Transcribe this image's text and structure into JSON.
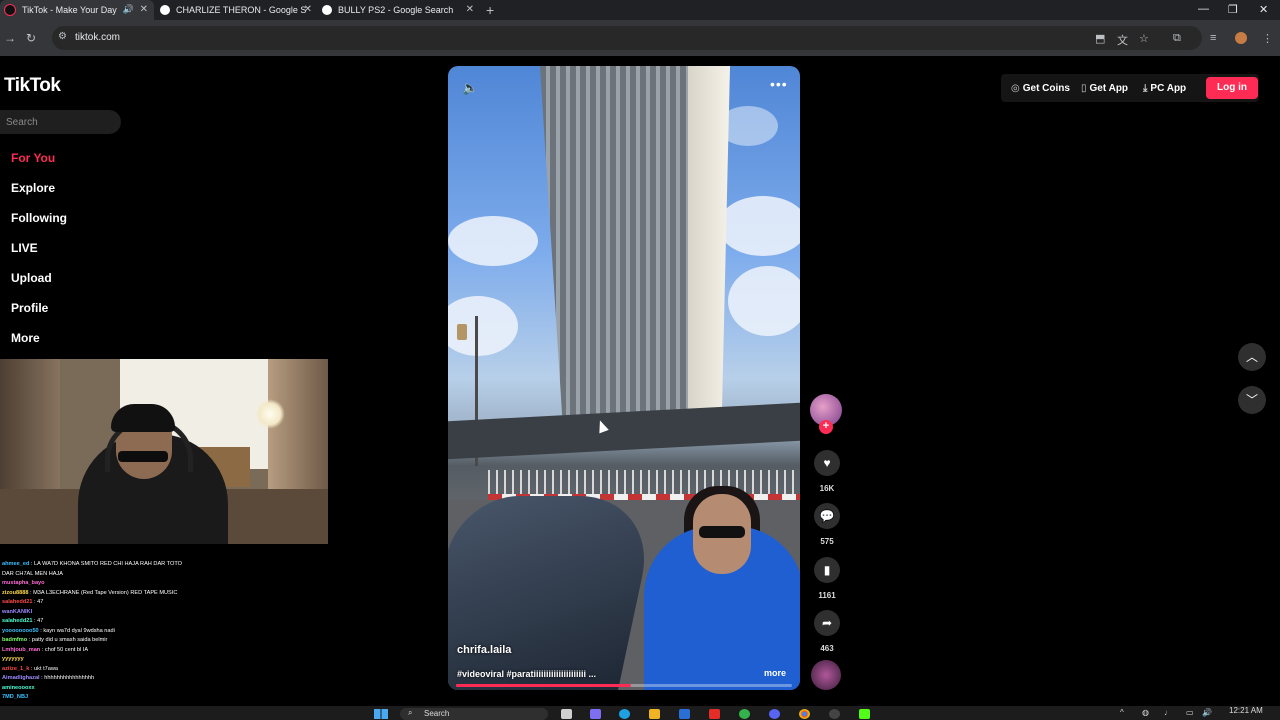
{
  "browser": {
    "tabs": [
      {
        "title": "TikTok - Make Your Day",
        "active": true
      },
      {
        "title": "CHARLIZE THERON - Google S",
        "active": false
      },
      {
        "title": "BULLY PS2 - Google Search",
        "active": false
      }
    ],
    "new_tab": "+",
    "url": "tiktok.com"
  },
  "tiktok": {
    "logo": "TikTok",
    "search_placeholder": "Search",
    "nav": [
      "For You",
      "Explore",
      "Following",
      "LIVE",
      "Upload",
      "Profile",
      "More"
    ],
    "header": {
      "get_coins": "Get Coins",
      "get_app": "Get App",
      "pc_app": "PC App",
      "login": "Log in"
    },
    "video": {
      "author": "chrifa.laila",
      "caption": "#videoviral #paratiiiiiiiiiiiiiiiiiiiii ...",
      "more": "more",
      "progress": 0.52
    },
    "actions": {
      "likes": "16K",
      "comments": "575",
      "saves": "1161",
      "shares": "463"
    }
  },
  "chat": [
    {
      "user": "ahmee_ed",
      "text": "LA WA7D KHONA SMITO RED CHI HAJA RAH DAR TOTO"
    },
    {
      "user": "",
      "text": "DAR CH7AL MEN HAJA"
    },
    {
      "user": "mustapha_bayo",
      "text": ""
    },
    {
      "user": "zizou8888",
      "text": "M3A L3ECHRANE (Red Tape Version) RED TAPE MUSIC"
    },
    {
      "user": "salahedd21",
      "text": "47"
    },
    {
      "user": "wanKANIKI",
      "text": ""
    },
    {
      "user": "salahedd21",
      "text": "47"
    },
    {
      "user": "yoooooooo50",
      "text": "kayn wa7d dyal 9wdsha nadi"
    },
    {
      "user": "badmfmo",
      "text": "patty did u smash saida belmir"
    },
    {
      "user": "Lmhjoub_man",
      "text": "chof 50 cent bl IA"
    },
    {
      "user": "yyyyyyy",
      "text": ""
    },
    {
      "user": "aziize_1_k",
      "text": "ukt t7awa"
    },
    {
      "user": "Aimadlighazal",
      "text": "hhhhhhhhhhhhhhhh"
    },
    {
      "user": "amineoooxx",
      "text": ""
    },
    {
      "user": "7MD_NBJ",
      "text": ""
    }
  ],
  "taskbar": {
    "search": "Search",
    "time": "12:21 AM"
  },
  "colors": {
    "accent": "#fe2c55",
    "bg": "#000000"
  }
}
